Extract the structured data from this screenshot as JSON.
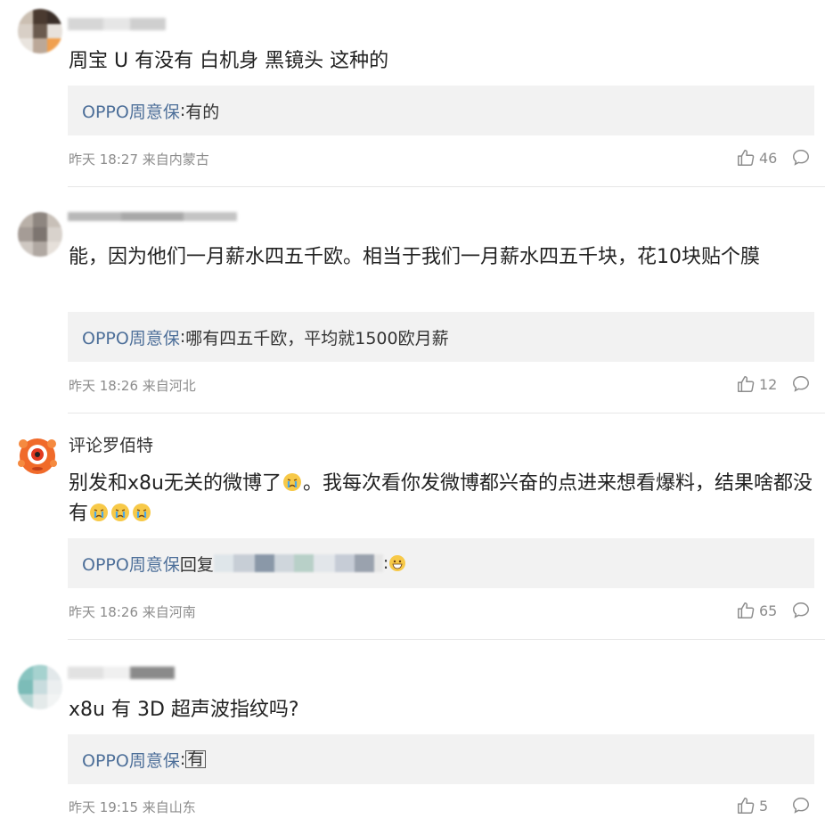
{
  "comments": [
    {
      "username": "",
      "text": "周宝 U 有没有 白机身 黑镜头 这种的",
      "reply_author": "OPPO周意保",
      "reply_sep": ":",
      "reply_text": "有的",
      "time": "昨天 18:27",
      "location": "来自内蒙古",
      "likes": "46"
    },
    {
      "username": "",
      "text": "能，因为他们一月薪水四五千欧。相当于我们一月薪水四五千块，花10块贴个膜",
      "reply_author": "OPPO周意保",
      "reply_sep": ":",
      "reply_text": "哪有四五千欧，平均就1500欧月薪",
      "time": "昨天 18:26",
      "location": "来自河北",
      "likes": "12"
    },
    {
      "username": "评论罗佰特",
      "text_part1": "别发和x8u无关的微博了",
      "text_part2": "。我每次看你发微博都兴奋的点进来想看爆料，结果啥都没有",
      "reply_author": "OPPO周意保",
      "reply_text_prefix": "回复",
      "reply_text_suffix": ":",
      "time": "昨天 18:26",
      "location": "来自河南",
      "likes": "65"
    },
    {
      "username": "",
      "text": "x8u 有 3D 超声波指纹吗?",
      "reply_author": "OPPO周意保",
      "reply_sep": ":",
      "reply_text": "有",
      "time": "昨天 19:15",
      "location": "来自山东",
      "likes": "5"
    }
  ],
  "icons": {
    "like": "thumbs-up-icon",
    "comment": "comment-bubble-icon",
    "avatar_bot": "red-robot-avatar",
    "emoji_cry": "crying-face-emoji",
    "emoji_grin": "grinning-face-emoji"
  },
  "colors": {
    "reply_author": "#4d6f99",
    "reply_bg": "#f2f2f2",
    "meta": "#8c8c8c",
    "divider": "#e6e6e6"
  }
}
